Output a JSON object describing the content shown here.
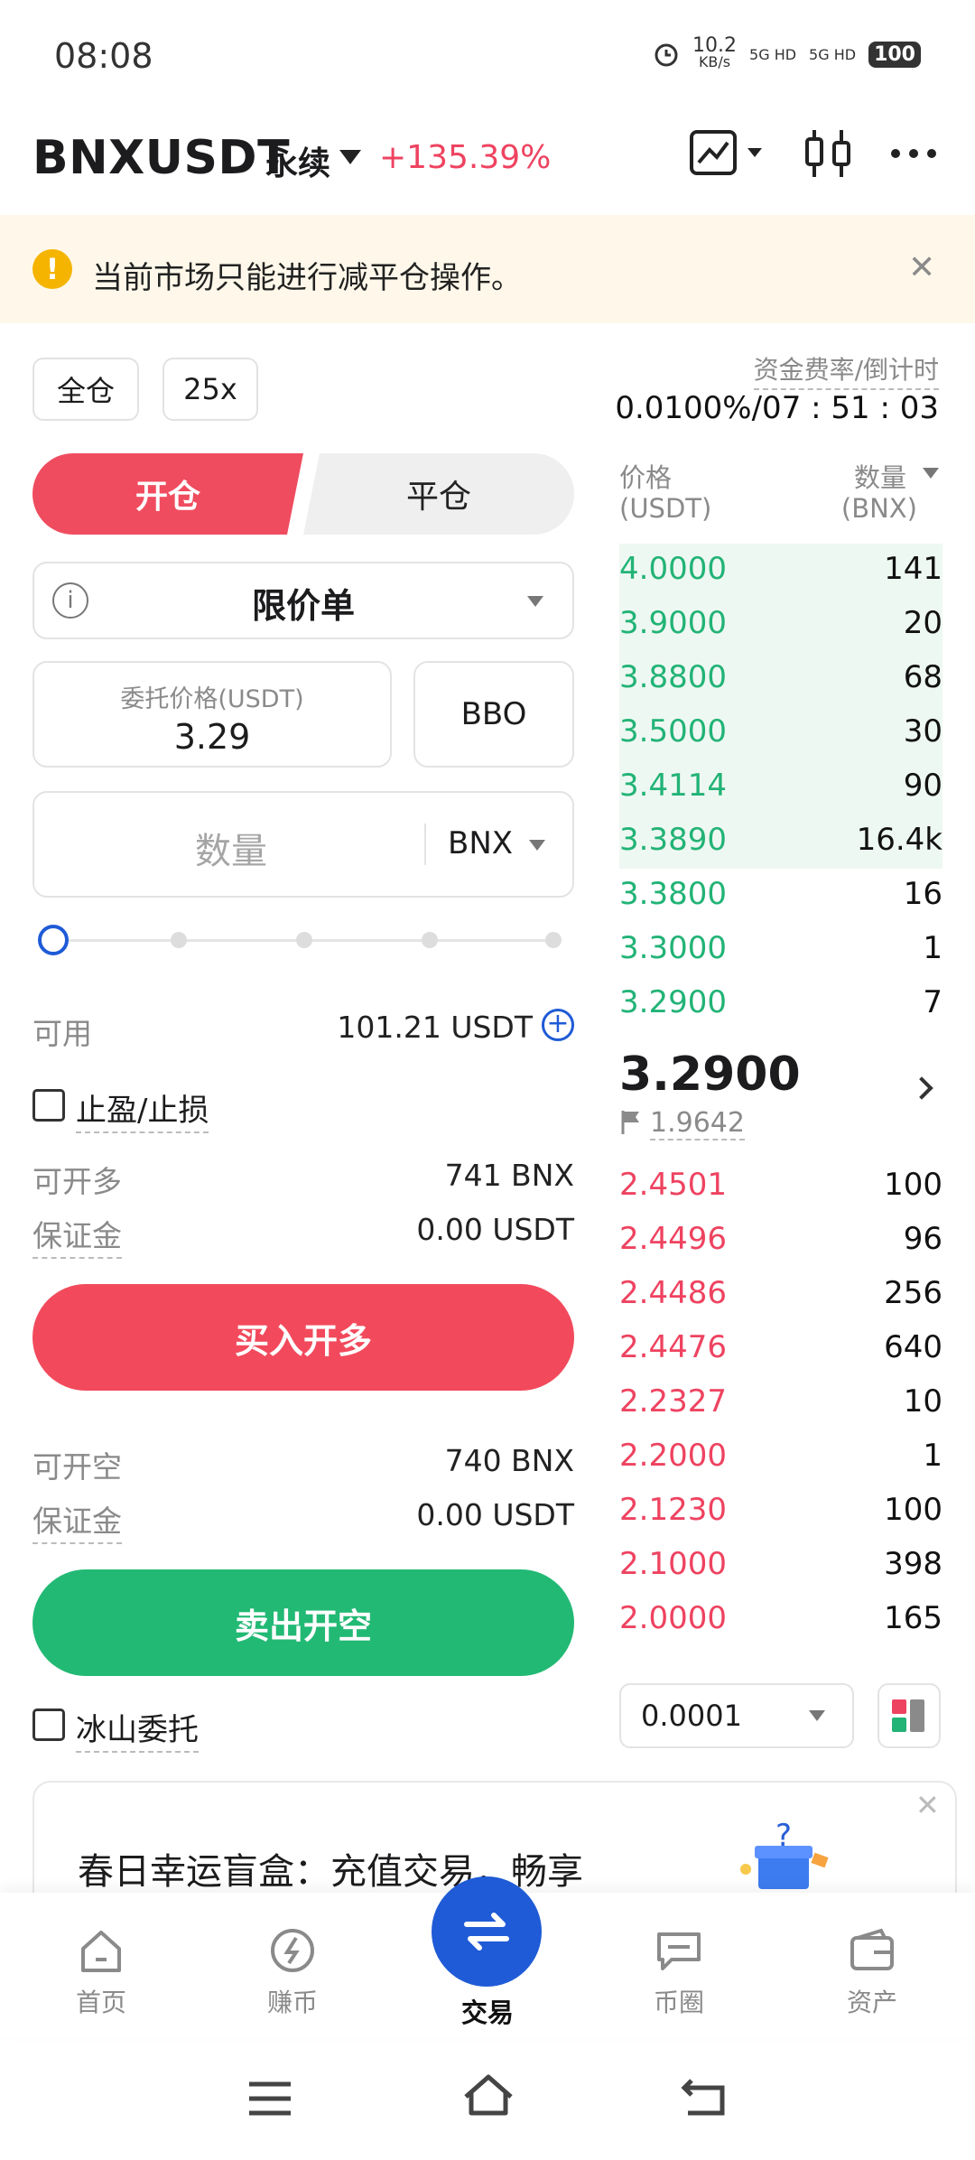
{
  "status_bar": {
    "time": "08:08",
    "speed": "10.2",
    "speed_unit": "KB/s",
    "net1": "5G HD",
    "net2": "5G HD",
    "battery": "100"
  },
  "header": {
    "symbol": "BNXUSDT",
    "contract_type": "永续",
    "change": "+135.39%"
  },
  "notice": {
    "text": "当前市场只能进行减平仓操作。"
  },
  "margin_mode": "全仓",
  "leverage": "25x",
  "funding": {
    "label": "资金费率/倒计时",
    "value": "0.0100%/07 : 51 : 03"
  },
  "tabs": {
    "open": "开仓",
    "close": "平仓"
  },
  "order_type": "限价单",
  "price_field": {
    "label": "委托价格(USDT)",
    "value": "3.29"
  },
  "bbo_label": "BBO",
  "quantity_field": {
    "placeholder": "数量",
    "unit": "BNX"
  },
  "slider": {
    "percent": 0
  },
  "available": {
    "label": "可用",
    "value": "101.21 USDT"
  },
  "tpsl": {
    "label": "止盈/止损",
    "checked": false
  },
  "long": {
    "max_label": "可开多",
    "max_value": "741 BNX",
    "margin_label": "保证金",
    "margin_value": "0.00 USDT",
    "button": "买入开多"
  },
  "short": {
    "max_label": "可开空",
    "max_value": "740 BNX",
    "margin_label": "保证金",
    "margin_value": "0.00 USDT",
    "button": "卖出开空"
  },
  "iceberg": {
    "label": "冰山委托",
    "checked": false
  },
  "orderbook": {
    "price_header": "价格",
    "price_unit": "(USDT)",
    "qty_header": "数量",
    "qty_unit": "(BNX)",
    "asks": [
      {
        "price": "4.0000",
        "qty": "141"
      },
      {
        "price": "3.9000",
        "qty": "20"
      },
      {
        "price": "3.8800",
        "qty": "68"
      },
      {
        "price": "3.5000",
        "qty": "30"
      },
      {
        "price": "3.4114",
        "qty": "90"
      },
      {
        "price": "3.3890",
        "qty": "16.4k"
      },
      {
        "price": "3.3800",
        "qty": "16"
      },
      {
        "price": "3.3000",
        "qty": "1"
      },
      {
        "price": "3.2900",
        "qty": "7"
      }
    ],
    "last_price": "3.2900",
    "mark_price": "1.9642",
    "bids": [
      {
        "price": "2.4501",
        "qty": "100"
      },
      {
        "price": "2.4496",
        "qty": "96"
      },
      {
        "price": "2.4486",
        "qty": "256"
      },
      {
        "price": "2.4476",
        "qty": "640"
      },
      {
        "price": "2.2327",
        "qty": "10"
      },
      {
        "price": "2.2000",
        "qty": "1"
      },
      {
        "price": "2.1230",
        "qty": "100"
      },
      {
        "price": "2.1000",
        "qty": "398"
      },
      {
        "price": "2.0000",
        "qty": "165"
      }
    ],
    "precision": "0.0001"
  },
  "banner": {
    "text": "春日幸运盲盒：充值交易，畅享"
  },
  "bottom_tabs": [
    {
      "label": "首页"
    },
    {
      "label": "赚币"
    },
    {
      "label": "交易"
    },
    {
      "label": "币圈"
    },
    {
      "label": "资产"
    }
  ],
  "colors": {
    "buy": "#22b376",
    "sell": "#ee4360",
    "accent": "#1f5bd6",
    "open_tab": "#f04c5f",
    "long_button": "#f24a5c",
    "short_button": "#22b974"
  }
}
